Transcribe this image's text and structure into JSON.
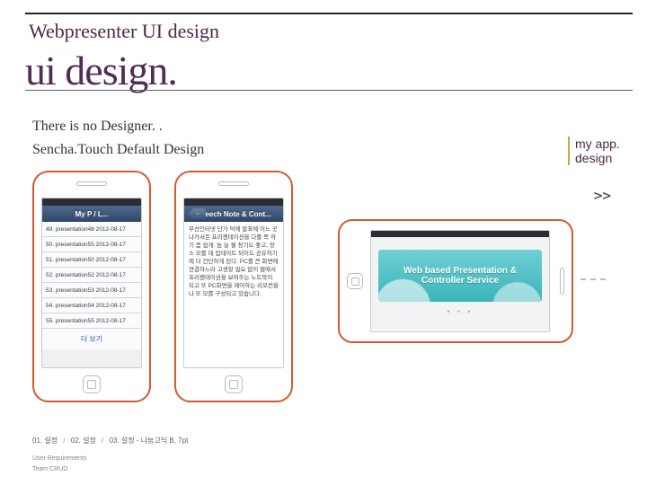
{
  "header": {
    "title": "Webpresenter UI design",
    "big_title": "ui design."
  },
  "subtitles": {
    "line1": "There is no Designer. .",
    "line2": "Sencha.Touch Default Design"
  },
  "right_sidebar": {
    "label": "my app. design",
    "arrow": ">>"
  },
  "phone1": {
    "nav_title": "My P / L...",
    "rows": [
      "49. presentation48 2012-08-17",
      "50. presentation55 2012-08-17",
      "51. presentation50 2012-08-17",
      "52. presentation52 2012-08-17",
      "53. presentation53 2012-08-17",
      "54. presentation54 2012-08-17",
      "55. presentation55 2012-08-17"
    ],
    "more_label": "더 보기"
  },
  "phone2": {
    "nav_back": "←",
    "nav_title": "Speech Note & Cont...",
    "note_text": "무선인터넷 단가 덕에 발표에 어느 곳 나가서든 프리젠테이션을 다룰 쪽 하기 좀 쉽게. 놈 늘 뭘 정기도 좋고, 장소 모를 데 업데이트 되어도 공유하기에 더 간단하게 된다. PC를 큰 화면에 연결하느라 고생할 필요 없이 웹에서 프리젠테이션을 보여주는 노트북이 되고 또 PC화면을 제어하는 리모컨을 나 또 모를 구성되고 있습니다."
  },
  "phone3": {
    "banner_text": "Web based Presentation & Controller Service",
    "dots": "• • •"
  },
  "footer": {
    "items": [
      "01. 설정",
      "02. 설정",
      "03. 설정 - 나눔고딕 B, 7pt"
    ],
    "note1": "User Requirements",
    "note2": "Team CRUD"
  }
}
